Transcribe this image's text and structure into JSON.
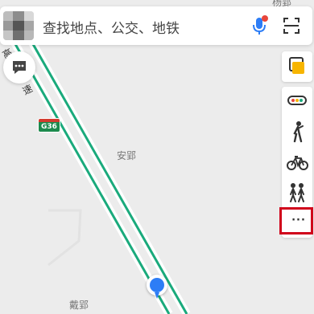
{
  "search": {
    "placeholder": "查找地点、公交、地铁"
  },
  "map": {
    "places": [
      {
        "name": "安郢"
      },
      {
        "name": "戴郢"
      },
      {
        "name": "杨郢"
      }
    ],
    "road_chars": [
      "高",
      "速"
    ],
    "highway_shield": "G36",
    "road_color": "#1aaa7c"
  },
  "toolbar": {
    "more_label": "···",
    "icons": [
      "layers-icon",
      "traffic-icon",
      "walk-icon",
      "bike-icon",
      "people-icon",
      "more-icon"
    ]
  },
  "colors": {
    "accent_blue": "#2d7df6",
    "highlight_red": "#d0021b",
    "mic_dot_red": "#e8463b",
    "layers_yellow": "#f7b500"
  }
}
